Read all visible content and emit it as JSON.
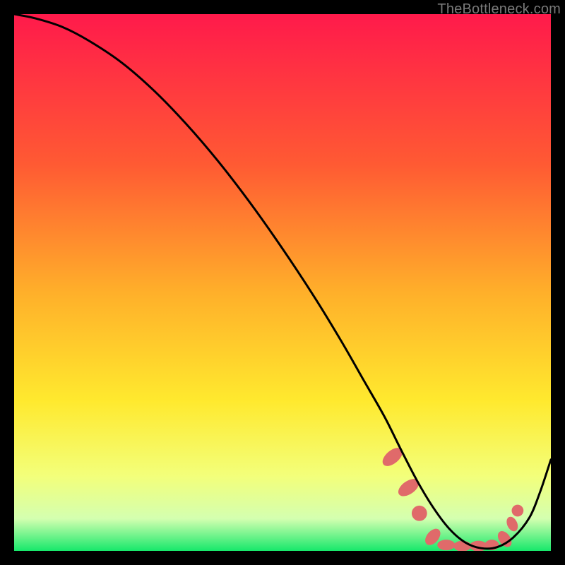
{
  "attribution": "TheBottleneck.com",
  "colors": {
    "red_top": "#ff1a4b",
    "orange": "#ff8a2a",
    "yellow": "#ffe92e",
    "pale_yellow": "#f6ffb0",
    "green": "#17e86b",
    "curve": "#000000",
    "marker_fill": "#e06a6a",
    "marker_stroke": "#c24d4d",
    "border": "#000000"
  },
  "chart_data": {
    "type": "line",
    "title": "",
    "xlabel": "",
    "ylabel": "",
    "xlim": [
      0,
      100
    ],
    "ylim": [
      0,
      100
    ],
    "curve": {
      "x": [
        0,
        4,
        9,
        14,
        20,
        26,
        32,
        38,
        44,
        50,
        56,
        61,
        65,
        69,
        72,
        75,
        78,
        81,
        84,
        87,
        90,
        93,
        96,
        98,
        100
      ],
      "y": [
        100,
        99.2,
        97.6,
        95,
        91,
        85.8,
        79.6,
        72.6,
        64.8,
        56.3,
        47.2,
        39,
        32,
        25,
        19,
        13.2,
        8.2,
        4.2,
        1.6,
        0.5,
        0.7,
        2.5,
        6.2,
        11,
        17
      ]
    },
    "flat_band_y": 0.9,
    "markers": [
      {
        "x": 70.5,
        "y": 17.5,
        "rx": 2.2,
        "ry": 4.0,
        "rot": 50
      },
      {
        "x": 73.5,
        "y": 11.8,
        "rx": 2.2,
        "ry": 4.0,
        "rot": 55
      },
      {
        "x": 75.5,
        "y": 7.0,
        "rx": 2.6,
        "ry": 2.6,
        "rot": 0
      },
      {
        "x": 78.0,
        "y": 2.6,
        "rx": 2.0,
        "ry": 3.2,
        "rot": 40
      },
      {
        "x": 80.5,
        "y": 1.1,
        "rx": 3.0,
        "ry": 1.8,
        "rot": 0
      },
      {
        "x": 83.5,
        "y": 0.9,
        "rx": 3.0,
        "ry": 1.8,
        "rot": 0
      },
      {
        "x": 86.5,
        "y": 0.9,
        "rx": 3.0,
        "ry": 1.8,
        "rot": 0
      },
      {
        "x": 89.0,
        "y": 1.1,
        "rx": 2.4,
        "ry": 1.8,
        "rot": 0
      },
      {
        "x": 91.4,
        "y": 2.2,
        "rx": 1.9,
        "ry": 3.0,
        "rot": -35
      },
      {
        "x": 92.8,
        "y": 5.0,
        "rx": 1.7,
        "ry": 2.6,
        "rot": -25
      },
      {
        "x": 93.8,
        "y": 7.5,
        "rx": 2.0,
        "ry": 2.0,
        "rot": 0
      }
    ]
  }
}
